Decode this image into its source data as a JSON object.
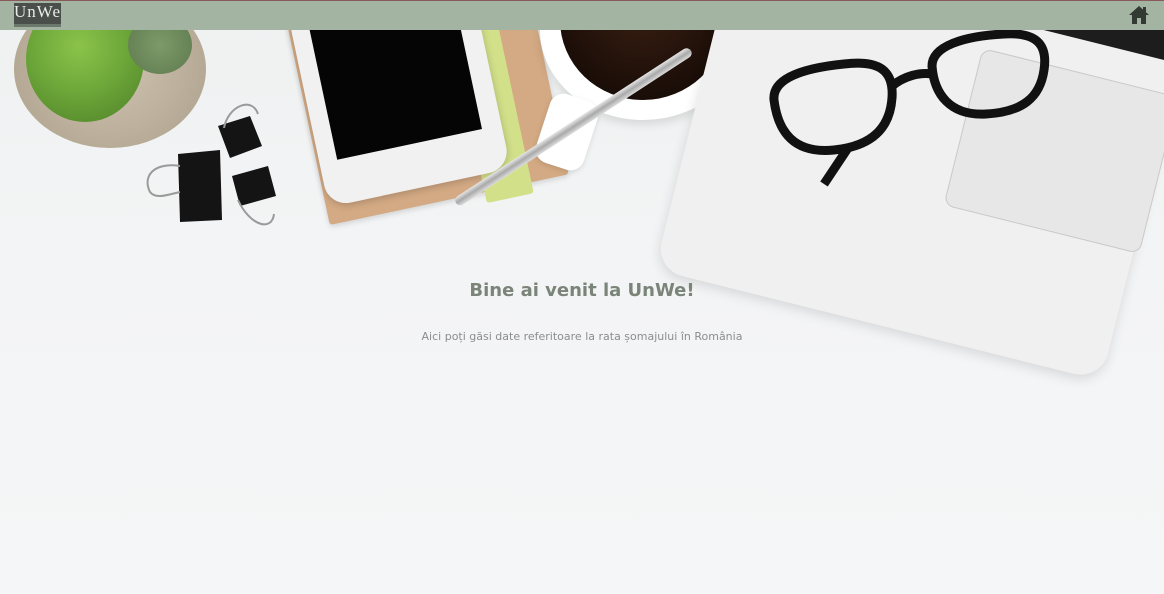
{
  "navbar": {
    "logo_text": "UnWe",
    "home_icon": "home-icon",
    "background_color": "#a3b5a2"
  },
  "main": {
    "title": "Bine ai venit la UnWe!",
    "subtitle": "Aici poți găsi date referitoare la rata șomajului în România"
  },
  "colors": {
    "title": "#7a8478",
    "subtitle": "#8a8d8e",
    "background": "#f3f4f5"
  }
}
